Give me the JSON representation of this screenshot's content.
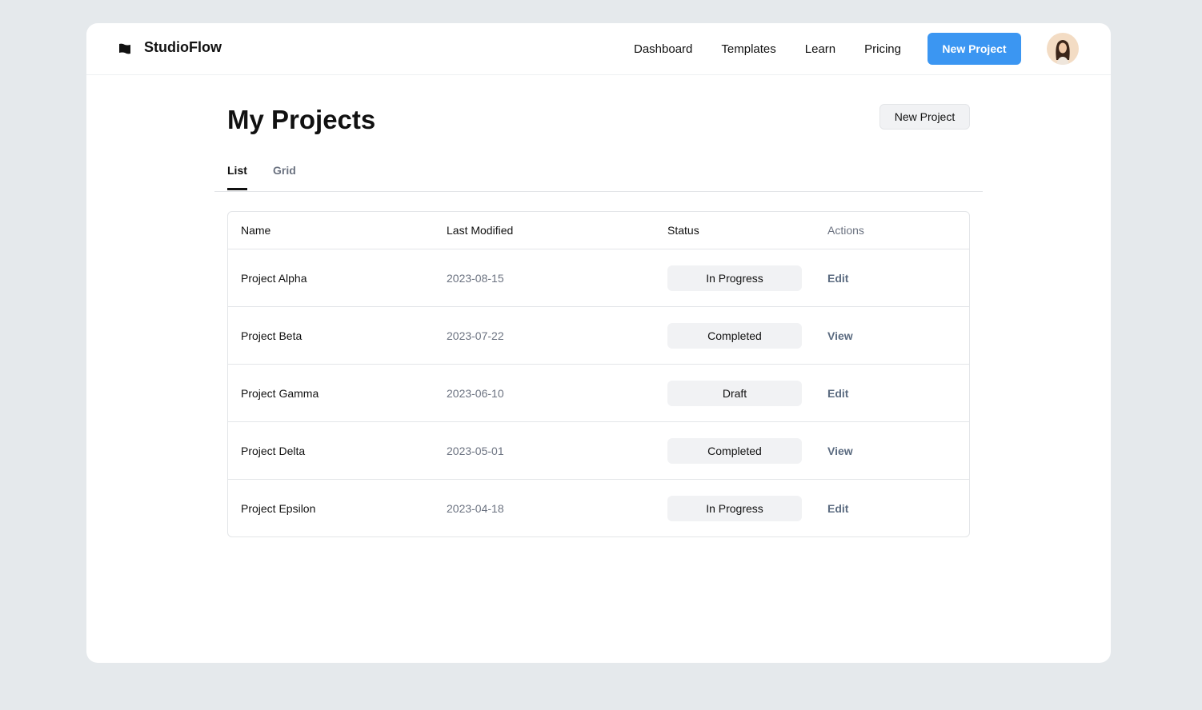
{
  "brand": "StudioFlow",
  "nav": [
    "Dashboard",
    "Templates",
    "Learn",
    "Pricing"
  ],
  "new_project": "New Project",
  "title": "My Projects",
  "tabs": [
    "List",
    "Grid"
  ],
  "columns": [
    "Name",
    "Last Modified",
    "Status",
    "Actions"
  ],
  "rows": [
    {
      "name": "Project Alpha",
      "date": "2023-08-15",
      "status": "In Progress",
      "action": "Edit"
    },
    {
      "name": "Project Beta",
      "date": "2023-07-22",
      "status": "Completed",
      "action": "View"
    },
    {
      "name": "Project Gamma",
      "date": "2023-06-10",
      "status": "Draft",
      "action": "Edit"
    },
    {
      "name": "Project Delta",
      "date": "2023-05-01",
      "status": "Completed",
      "action": "View"
    },
    {
      "name": "Project Epsilon",
      "date": "2023-04-18",
      "status": "In Progress",
      "action": "Edit"
    }
  ]
}
